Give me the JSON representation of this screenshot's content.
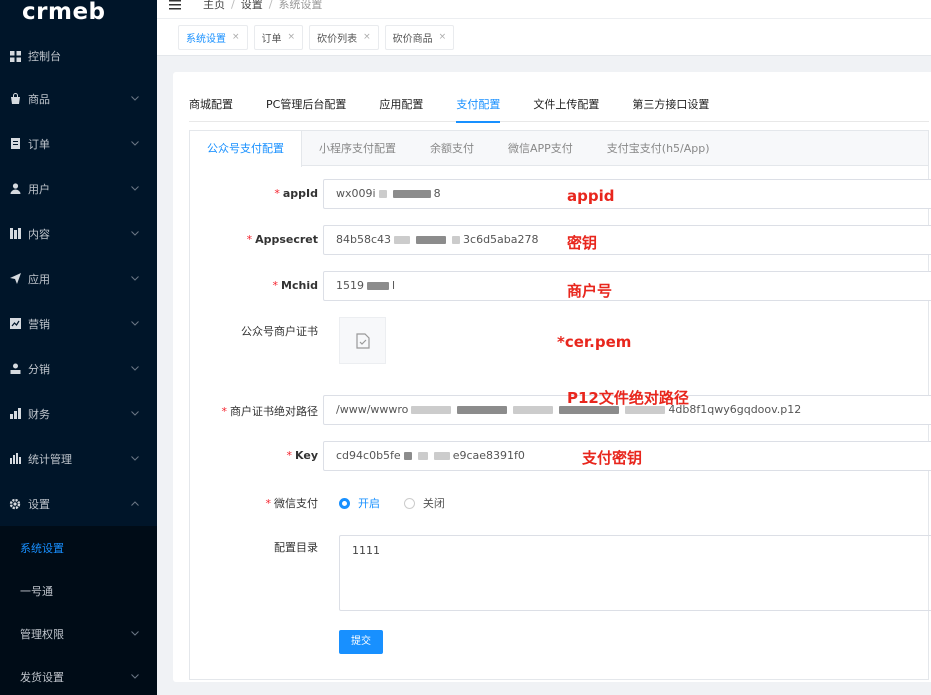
{
  "logo": "crmeb",
  "sidebar": {
    "items": [
      {
        "label": "控制台",
        "icon": "dashboard-icon"
      },
      {
        "label": "商品",
        "icon": "bag-icon"
      },
      {
        "label": "订单",
        "icon": "order-icon"
      },
      {
        "label": "用户",
        "icon": "user-icon"
      },
      {
        "label": "内容",
        "icon": "content-icon"
      },
      {
        "label": "应用",
        "icon": "send-icon"
      },
      {
        "label": "营销",
        "icon": "marketing-icon"
      },
      {
        "label": "分销",
        "icon": "distribution-icon"
      },
      {
        "label": "财务",
        "icon": "finance-icon"
      },
      {
        "label": "统计管理",
        "icon": "stats-icon"
      },
      {
        "label": "设置",
        "icon": "gear-icon"
      }
    ],
    "submenu": [
      {
        "label": "系统设置",
        "active": true
      },
      {
        "label": "一号通",
        "active": false
      },
      {
        "label": "管理权限",
        "active": false
      },
      {
        "label": "发货设置",
        "active": false
      }
    ]
  },
  "breadcrumb": [
    "主页",
    "设置",
    "系统设置"
  ],
  "tags": [
    {
      "label": "系统设置",
      "active": true
    },
    {
      "label": "订单",
      "active": false
    },
    {
      "label": "砍价列表",
      "active": false
    },
    {
      "label": "砍价商品",
      "active": false
    }
  ],
  "top_tabs": [
    "商城配置",
    "PC管理后台配置",
    "应用配置",
    "支付配置",
    "文件上传配置",
    "第三方接口设置"
  ],
  "top_tab_active": 3,
  "inner_tabs": [
    "公众号支付配置",
    "小程序支付配置",
    "余额支付",
    "微信APP支付",
    "支付宝支付(h5/App)"
  ],
  "form": {
    "appid": {
      "label": "appId",
      "v1": "wx009i",
      "v2": "8"
    },
    "appsecret": {
      "label": "Appsecret",
      "v1": "84b58c43",
      "v2": "3c6d5aba278"
    },
    "mchid": {
      "label": "Mchid",
      "v1": "1519",
      "v2": "l"
    },
    "cert": {
      "label": "公众号商户证书"
    },
    "certpath": {
      "label": "商户证书绝对路径",
      "v1": "/www/wwwro",
      "v2": "4db8f1qwy6gqdoov.p12"
    },
    "key": {
      "label": "Key",
      "v1": "cd94c0b5fe",
      "v2": "e9cae8391f0"
    },
    "wxpay": {
      "label": "微信支付",
      "on": "开启",
      "off": "关闭"
    },
    "dir": {
      "label": "配置目录",
      "value": "1111"
    },
    "submit": "提交"
  },
  "annotations": {
    "appid": "appid",
    "secret": "密钥",
    "mchid": "商户号",
    "cer": "*cer.pem",
    "p12": "P12文件绝对路径",
    "key": "支付密钥"
  },
  "colors": {
    "primary": "#1890ff",
    "sidebar": "#001529",
    "annotation": "#e8261d"
  }
}
